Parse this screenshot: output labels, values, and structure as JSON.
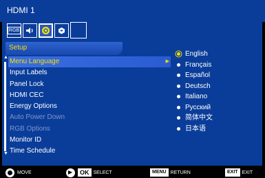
{
  "window_title": "HDMI 1",
  "toolbar": {
    "rgb_label": "RGB",
    "icons": [
      "rgb-icon",
      "speaker-icon",
      "setup-icon",
      "camera-icon",
      "empty-icon"
    ]
  },
  "section_title": "Setup",
  "menu": {
    "items": [
      {
        "label": "Menu Language",
        "state": "active"
      },
      {
        "label": "Input Labels",
        "state": "normal"
      },
      {
        "label": "Panel Lock",
        "state": "normal"
      },
      {
        "label": "HDMI CEC",
        "state": "normal"
      },
      {
        "label": "Energy Options",
        "state": "normal"
      },
      {
        "label": "Auto Power Down",
        "state": "disabled"
      },
      {
        "label": "RGB Options",
        "state": "disabled"
      },
      {
        "label": "Monitor ID",
        "state": "normal"
      },
      {
        "label": "Time Schedule",
        "state": "normal"
      }
    ]
  },
  "languages": [
    {
      "label": "English",
      "selected": true
    },
    {
      "label": "Français",
      "selected": false
    },
    {
      "label": "Español",
      "selected": false
    },
    {
      "label": "Deutsch",
      "selected": false
    },
    {
      "label": "Italiano",
      "selected": false
    },
    {
      "label": "Русский",
      "selected": false
    },
    {
      "label": "简体中文",
      "selected": false
    },
    {
      "label": "日本语",
      "selected": false
    }
  ],
  "footer": {
    "move": "MOVE",
    "ok_key": "OK",
    "select": "SELECT",
    "menu_key": "MENU",
    "return": "RETURN",
    "exit_key": "EXIT",
    "exit": "EXIT"
  },
  "colors": {
    "background": "#0a3d9a",
    "highlight": "#f5e000"
  }
}
